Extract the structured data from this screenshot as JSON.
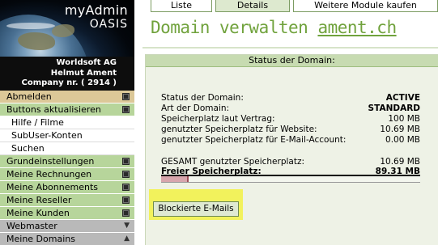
{
  "sidebar": {
    "logo": {
      "line1": "myAdmin",
      "line2": "OASIS"
    },
    "company": {
      "line1": "Worldsoft AG",
      "line2": "Helmut Ament",
      "line3": "Company nr. ( 2914 )"
    },
    "items": [
      {
        "label": "Abmelden"
      },
      {
        "label": "Buttons aktualisieren"
      },
      {
        "label": "Hilfe / Filme"
      },
      {
        "label": "SubUser-Konten"
      },
      {
        "label": "Suchen"
      },
      {
        "label": "Grundeinstellungen"
      },
      {
        "label": "Meine Rechnungen"
      },
      {
        "label": "Meine Abonnements"
      },
      {
        "label": "Meine Reseller"
      },
      {
        "label": "Meine Kunden"
      },
      {
        "label": "Webmaster"
      },
      {
        "label": "Meine Domains"
      }
    ]
  },
  "tabs": [
    {
      "label": "Liste"
    },
    {
      "label": "Details"
    },
    {
      "label": "Weitere Module kaufen"
    }
  ],
  "title": {
    "prefix": "Domain verwalten",
    "domain": "ament.ch"
  },
  "panel": {
    "heading": "Status der Domain:",
    "rows": [
      {
        "label": "Status der Domain:",
        "value": "ACTIVE"
      },
      {
        "label": "Art der Domain:",
        "value": "STANDARD"
      },
      {
        "label": "Speicherplatz laut Vertrag:",
        "value": "100 MB"
      },
      {
        "label": "genutzter Speicherplatz für Website:",
        "value": "10.69 MB"
      },
      {
        "label": "genutzter Speicherplatz für E-Mail-Account:",
        "value": "0.00 MB"
      }
    ],
    "total": {
      "label": "GESAMT genutzter Speicherplatz:",
      "value": "10.69 MB"
    },
    "free": {
      "label": "Freier Speicherplatz:",
      "value": "89.31 MB"
    },
    "usage_fraction": 0.1069,
    "mail_button": "Blockierte E-Mails"
  },
  "colors": {
    "accent_green": "#70a23c",
    "menu_green": "#b7d59b",
    "menu_tan": "#dcc898",
    "highlight_yellow": "#f2f25c"
  }
}
